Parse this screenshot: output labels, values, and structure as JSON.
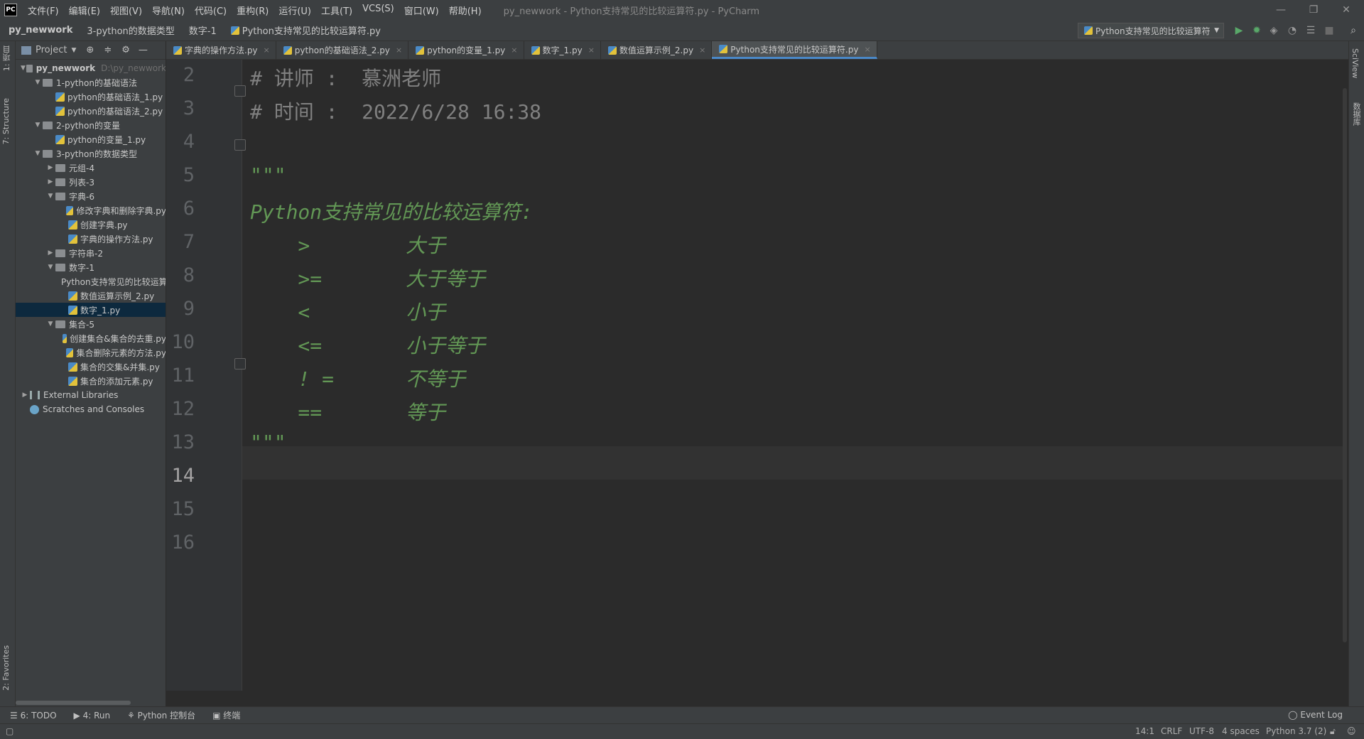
{
  "window": {
    "app_label": "PC",
    "menu": [
      "文件(F)",
      "编辑(E)",
      "视图(V)",
      "导航(N)",
      "代码(C)",
      "重构(R)",
      "运行(U)",
      "工具(T)",
      "VCS(S)",
      "窗口(W)",
      "帮助(H)"
    ],
    "title": "py_newwork - Python支持常见的比较运算符.py - PyCharm",
    "controls": {
      "minimize": "—",
      "restore": "❐",
      "close": "✕"
    }
  },
  "breadcrumb": [
    "py_newwork",
    "3-python的数据类型",
    "数字-1",
    "Python支持常见的比较运算符.py"
  ],
  "run_config": {
    "label": "Python支持常见的比较运算符"
  },
  "left_tool_tabs": [
    "1: 项目",
    "7: Structure",
    "2: Favorites"
  ],
  "right_tool_tabs": [
    "SciView",
    "数据库"
  ],
  "project_panel": {
    "title": "Project",
    "tree": [
      {
        "label": "py_newwork",
        "hint": "D:\\py_newwork",
        "level": 0,
        "type": "root",
        "expanded": true
      },
      {
        "label": "1-python的基础语法",
        "level": 1,
        "type": "folder",
        "expanded": true
      },
      {
        "label": "python的基础语法_1.py",
        "level": 2,
        "type": "file"
      },
      {
        "label": "python的基础语法_2.py",
        "level": 2,
        "type": "file"
      },
      {
        "label": "2-python的变量",
        "level": 1,
        "type": "folder",
        "expanded": true
      },
      {
        "label": "python的变量_1.py",
        "level": 2,
        "type": "file"
      },
      {
        "label": "3-python的数据类型",
        "level": 1,
        "type": "folder",
        "expanded": true
      },
      {
        "label": "元组-4",
        "level": 2,
        "type": "folder",
        "expanded": false
      },
      {
        "label": "列表-3",
        "level": 2,
        "type": "folder",
        "expanded": false
      },
      {
        "label": "字典-6",
        "level": 2,
        "type": "folder",
        "expanded": true
      },
      {
        "label": "修改字典和删除字典.py",
        "level": 3,
        "type": "file"
      },
      {
        "label": "创建字典.py",
        "level": 3,
        "type": "file"
      },
      {
        "label": "字典的操作方法.py",
        "level": 3,
        "type": "file"
      },
      {
        "label": "字符串-2",
        "level": 2,
        "type": "folder",
        "expanded": false
      },
      {
        "label": "数字-1",
        "level": 2,
        "type": "folder",
        "expanded": true
      },
      {
        "label": "Python支持常见的比较运算符.py",
        "level": 3,
        "type": "file"
      },
      {
        "label": "数值运算示例_2.py",
        "level": 3,
        "type": "file"
      },
      {
        "label": "数字_1.py",
        "level": 3,
        "type": "file",
        "selected": true
      },
      {
        "label": "集合-5",
        "level": 2,
        "type": "folder",
        "expanded": true
      },
      {
        "label": "创建集合&集合的去重.py",
        "level": 3,
        "type": "file"
      },
      {
        "label": "集合删除元素的方法.py",
        "level": 3,
        "type": "file"
      },
      {
        "label": "集合的交集&并集.py",
        "level": 3,
        "type": "file"
      },
      {
        "label": "集合的添加元素.py",
        "level": 3,
        "type": "file"
      },
      {
        "label": "External Libraries",
        "level": 0,
        "type": "lib",
        "expanded": false
      },
      {
        "label": "Scratches and Consoles",
        "level": 0,
        "type": "scratch"
      }
    ]
  },
  "tabs": [
    {
      "label": "字典的操作方法.py"
    },
    {
      "label": "python的基础语法_2.py"
    },
    {
      "label": "python的变量_1.py"
    },
    {
      "label": "数字_1.py"
    },
    {
      "label": "数值运算示例_2.py"
    },
    {
      "label": "Python支持常见的比较运算符.py",
      "active": true
    }
  ],
  "editor": {
    "current_line": 14,
    "lines": [
      {
        "num": "2",
        "text": "# 讲师 :  慕洲老师",
        "style": "comment"
      },
      {
        "num": "3",
        "text": "# 时间 :  2022/6/28 16:38",
        "style": "comment"
      },
      {
        "num": "4",
        "text": "",
        "style": "comment"
      },
      {
        "num": "5",
        "text": "\"\"\"",
        "style": "docstr"
      },
      {
        "num": "6",
        "text": "Python支持常见的比较运算符:",
        "style": "docstr"
      },
      {
        "num": "7",
        "text": "    >        大于",
        "style": "docstr"
      },
      {
        "num": "8",
        "text": "    >=       大于等于",
        "style": "docstr"
      },
      {
        "num": "9",
        "text": "    <        小于",
        "style": "docstr"
      },
      {
        "num": "10",
        "text": "    <=       小于等于",
        "style": "docstr"
      },
      {
        "num": "11",
        "text": "    ! =      不等于",
        "style": "docstr"
      },
      {
        "num": "12",
        "text": "    ==       等于",
        "style": "docstr"
      },
      {
        "num": "13",
        "text": "\"\"\"",
        "style": "docstr"
      },
      {
        "num": "14",
        "text": "",
        "style": "docstr"
      },
      {
        "num": "15",
        "text": "",
        "style": "docstr"
      },
      {
        "num": "16",
        "text": "",
        "style": "docstr"
      }
    ]
  },
  "bottom_tools": [
    "6: TODO",
    "4: Run",
    "Python 控制台",
    "终端"
  ],
  "event_log": "Event Log",
  "status": {
    "position": "14:1",
    "line_sep": "CRLF",
    "encoding": "UTF-8",
    "indent": "4 spaces",
    "interpreter": "Python 3.7 (2)"
  },
  "colors": {
    "editor_bg": "#2b2b2b",
    "panel_bg": "#3c3f41",
    "comment": "#808080",
    "docstring": "#629755",
    "selection": "#0d293e",
    "tab_accent": "#4a88c7"
  }
}
